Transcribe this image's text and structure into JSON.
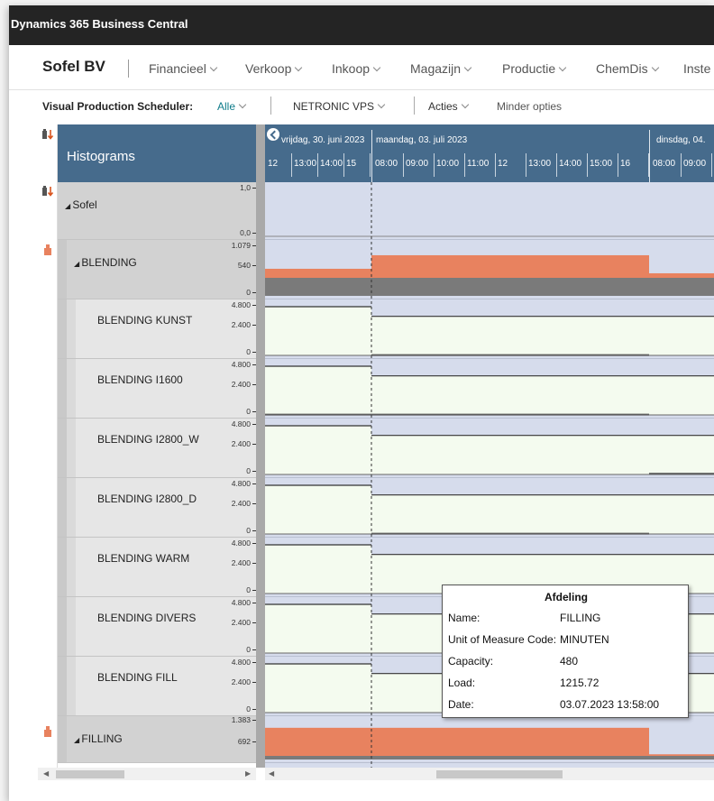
{
  "app": {
    "title": "Dynamics 365 Business Central"
  },
  "nav": {
    "company": "Sofel BV",
    "items": [
      "Financieel",
      "Verkoop",
      "Inkoop",
      "Magazijn",
      "Productie",
      "ChemDis",
      "Inste"
    ]
  },
  "actionbar": {
    "label": "Visual Production Scheduler:",
    "filter_value": "Alle",
    "vps_menu": "NETRONIC VPS",
    "actions_menu": "Acties",
    "fewer_options": "Minder opties"
  },
  "scheduler": {
    "panel_title": "Histograms",
    "days": [
      "vrijdag, 30. juni 2023",
      "maandag, 03. juli 2023",
      "dinsdag, 04."
    ],
    "hours_fri": [
      "12",
      "13:00",
      "14:00",
      "15"
    ],
    "hours_mon": [
      "08:00",
      "09:00",
      "10:00",
      "11:00",
      "12",
      "13:00",
      "14:00",
      "15:00",
      "16"
    ],
    "hours_tue": [
      "08:00",
      "09:00"
    ],
    "rows": [
      {
        "name": "Sofel",
        "level": 0,
        "ticks": [
          "1,0",
          "0,0"
        ],
        "capacity": [
          1.0,
          1.0,
          1.0
        ],
        "load": [
          0,
          0,
          0
        ],
        "max": 1.0
      },
      {
        "name": "BLENDING",
        "level": 1,
        "ticks": [
          "1.079",
          "540",
          "0"
        ],
        "capacity": [
          300,
          300,
          300
        ],
        "load": [
          600,
          900,
          500
        ],
        "max": 1079
      },
      {
        "name": "BLENDING KUNST",
        "level": 2,
        "ticks": [
          "4.800",
          "2.400",
          "0"
        ],
        "capacity": [
          4800,
          3850,
          3850
        ],
        "load": [
          0,
          120,
          0
        ],
        "max": 4800
      },
      {
        "name": "BLENDING I1600",
        "level": 2,
        "ticks": [
          "4.800",
          "2.400",
          "0"
        ],
        "capacity": [
          4800,
          3850,
          3850
        ],
        "load": [
          120,
          120,
          0
        ],
        "max": 4800
      },
      {
        "name": "BLENDING I2800_W",
        "level": 2,
        "ticks": [
          "4.800",
          "2.400",
          "0"
        ],
        "capacity": [
          4800,
          3850,
          3850
        ],
        "load": [
          0,
          0,
          160
        ],
        "max": 4800
      },
      {
        "name": "BLENDING I2800_D",
        "level": 2,
        "ticks": [
          "4.800",
          "2.400",
          "0"
        ],
        "capacity": [
          4800,
          3850,
          3850
        ],
        "load": [
          0,
          120,
          0
        ],
        "max": 4800
      },
      {
        "name": "BLENDING WARM",
        "level": 2,
        "ticks": [
          "4.800",
          "2.400",
          "0"
        ],
        "capacity": [
          4800,
          3850,
          3850
        ],
        "load": [
          0,
          0,
          0
        ],
        "max": 4800
      },
      {
        "name": "BLENDING DIVERS",
        "level": 2,
        "ticks": [
          "4.800",
          "2.400",
          "0"
        ],
        "capacity": [
          4800,
          3850,
          3850
        ],
        "load": [
          0,
          0,
          0
        ],
        "max": 4800
      },
      {
        "name": "BLENDING FILL",
        "level": 2,
        "ticks": [
          "4.800",
          "2.400",
          "0"
        ],
        "capacity": [
          4800,
          3850,
          3850
        ],
        "load": [
          0,
          0,
          0
        ],
        "max": 4800
      },
      {
        "name": "FILLING",
        "level": 1,
        "ticks": [
          "1.383",
          "692"
        ],
        "capacity": [
          480,
          480,
          480
        ],
        "load": [
          1215.72,
          1215.72,
          200
        ],
        "max": 1383
      }
    ]
  },
  "tooltip": {
    "title": "Afdeling",
    "fields": [
      {
        "key": "Name:",
        "value": "FILLING"
      },
      {
        "key": "Unit of Measure Code:",
        "value": "MINUTEN"
      },
      {
        "key": "Capacity:",
        "value": "480"
      },
      {
        "key": "Load:",
        "value": "1215.72"
      },
      {
        "key": "Date:",
        "value": "03.07.2023 13:58:00"
      }
    ]
  },
  "colors": {
    "header": "#466b8c",
    "load": "#e8825f",
    "capacity_line": "#333333",
    "free": "#f4fbef",
    "nonwork": "#d6dcec",
    "parent_base": "#7a7a7a"
  }
}
